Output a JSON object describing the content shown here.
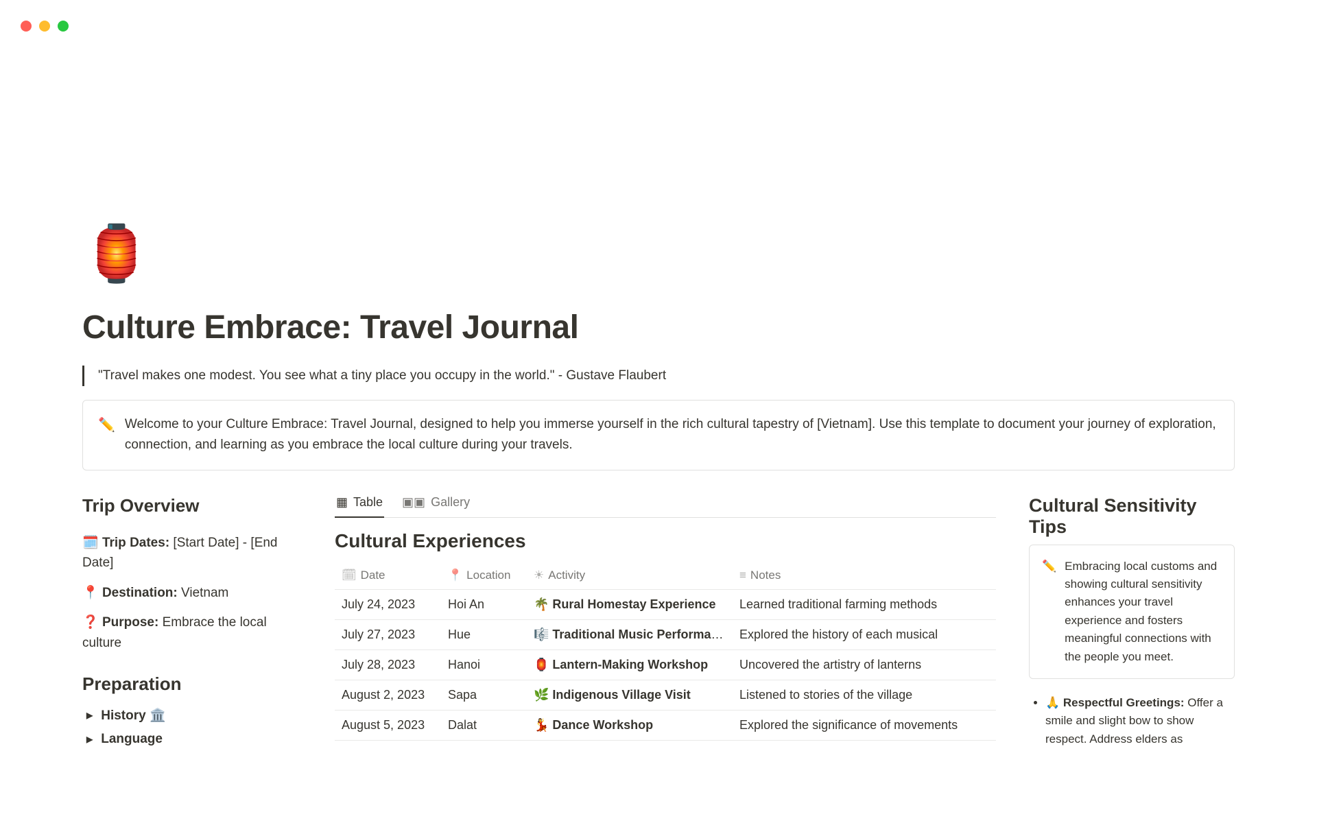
{
  "icon": "🏮",
  "title": "Culture Embrace: Travel Journal",
  "quote": "\"Travel makes one modest. You see what a tiny place you occupy in the world.\" - Gustave Flaubert",
  "welcome_icon": "✏️",
  "welcome": "Welcome to your Culture Embrace: Travel Journal, designed to help you immerse yourself in the rich cultural tapestry of [Vietnam]. Use this template to document your journey of exploration, connection, and learning as you embrace the local culture during your travels.",
  "left": {
    "overview_heading": "Trip Overview",
    "dates_icon": "🗓️",
    "dates_label": "Trip Dates:",
    "dates_value": " [Start Date] - [End Date]",
    "dest_icon": "📍",
    "dest_label": "Destination:",
    "dest_value": " Vietnam",
    "purpose_icon": "❓",
    "purpose_label": "Purpose:",
    "purpose_value": " Embrace the local culture",
    "prep_heading": "Preparation",
    "toggle1": "History 🏛️",
    "toggle2": "Language"
  },
  "tabs": {
    "table": "Table",
    "gallery": "Gallery"
  },
  "db": {
    "title": "Cultural Experiences",
    "cols": {
      "date": "Date",
      "location": "Location",
      "activity": "Activity",
      "notes": "Notes"
    },
    "rows": [
      {
        "date": "July 24, 2023",
        "loc": "Hoi An",
        "icon": "🌴",
        "act": "Rural Homestay Experience",
        "notes": "Learned traditional farming methods"
      },
      {
        "date": "July 27, 2023",
        "loc": "Hue",
        "icon": "🎼",
        "act": "Traditional Music Performance",
        "notes": "Explored the history of each musical"
      },
      {
        "date": "July 28, 2023",
        "loc": "Hanoi",
        "icon": "🏮",
        "act": "Lantern-Making Workshop",
        "notes": "Uncovered the artistry of lanterns"
      },
      {
        "date": "August 2, 2023",
        "loc": "Sapa",
        "icon": "🌿",
        "act": "Indigenous Village Visit",
        "notes": "Listened to stories of the village"
      },
      {
        "date": "August 5, 2023",
        "loc": "Dalat",
        "icon": "💃",
        "act": "Dance Workshop",
        "notes": "Explored the significance of movements"
      }
    ]
  },
  "right": {
    "heading": "Cultural Sensitivity Tips",
    "callout_icon": "✏️",
    "callout": "Embracing local customs and showing cultural sensitivity enhances your travel experience and fosters meaningful connections with the people you meet.",
    "tip_icon": "🙏",
    "tip_label": "Respectful Greetings:",
    "tip_text": " Offer a smile and slight bow to show respect. Address elders as"
  }
}
